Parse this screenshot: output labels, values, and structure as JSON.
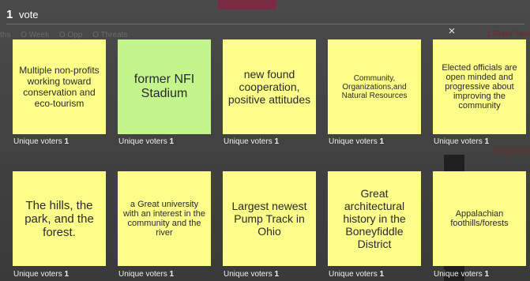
{
  "background": {
    "strip": [
      "ths",
      "O Week",
      "O Opp",
      "O Threats"
    ],
    "right_label": "1 River Tow",
    "right_label_2": "4 Opportu"
  },
  "header": {
    "vote_count": "1",
    "vote_label": "vote",
    "close_icon": "×"
  },
  "voters_label": "Unique voters",
  "cards": [
    {
      "text": "Multiple non-profits working toward conservation and eco-tourism",
      "voters": "1",
      "color": "#fdfd8a"
    },
    {
      "text": "former NFI Stadium",
      "voters": "1",
      "color": "#c4f58d"
    },
    {
      "text": "new found cooperation, positive attitudes",
      "voters": "1",
      "color": "#fdfd8a"
    },
    {
      "text": "Community, Organizations,and Natural Resources",
      "voters": "1",
      "color": "#fdfd8a"
    },
    {
      "text": "Elected officials are open minded and progressive about improving the community",
      "voters": "1",
      "color": "#fdfd8a"
    },
    {
      "text": "The hills, the park, and the forest.",
      "voters": "1",
      "color": "#fdfd8a"
    },
    {
      "text": "a Great university with an interest in the community and the river",
      "voters": "1",
      "color": "#fdfd8a"
    },
    {
      "text": "Largest newest Pump Track in Ohio",
      "voters": "1",
      "color": "#fdfd8a"
    },
    {
      "text": "Great architectural history in the Boneyfiddle District",
      "voters": "1",
      "color": "#fdfd8a"
    },
    {
      "text": "Appalachian foothills/forests",
      "voters": "1",
      "color": "#fdfd8a"
    }
  ]
}
